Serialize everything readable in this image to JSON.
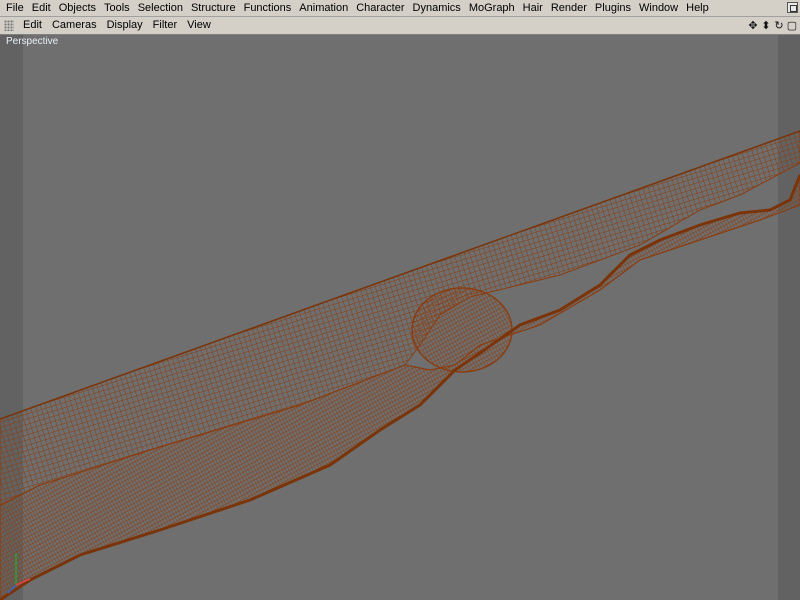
{
  "menubar": {
    "items": [
      "File",
      "Edit",
      "Objects",
      "Tools",
      "Selection",
      "Structure",
      "Functions",
      "Animation",
      "Character",
      "Dynamics",
      "MoGraph",
      "Hair",
      "Render",
      "Plugins",
      "Window",
      "Help"
    ]
  },
  "toolbar": {
    "items": [
      "Edit",
      "Cameras",
      "Display",
      "Filter",
      "View"
    ],
    "nav_icons": [
      {
        "name": "move-view-icon",
        "glyph": "✥"
      },
      {
        "name": "zoom-view-icon",
        "glyph": "⬍"
      },
      {
        "name": "rotate-view-icon",
        "glyph": "↻"
      },
      {
        "name": "toggle-views-icon",
        "glyph": "▢"
      }
    ]
  },
  "viewport": {
    "label": "Perspective",
    "background": "#6f6f6f",
    "wire_color": "#8a3d10"
  }
}
